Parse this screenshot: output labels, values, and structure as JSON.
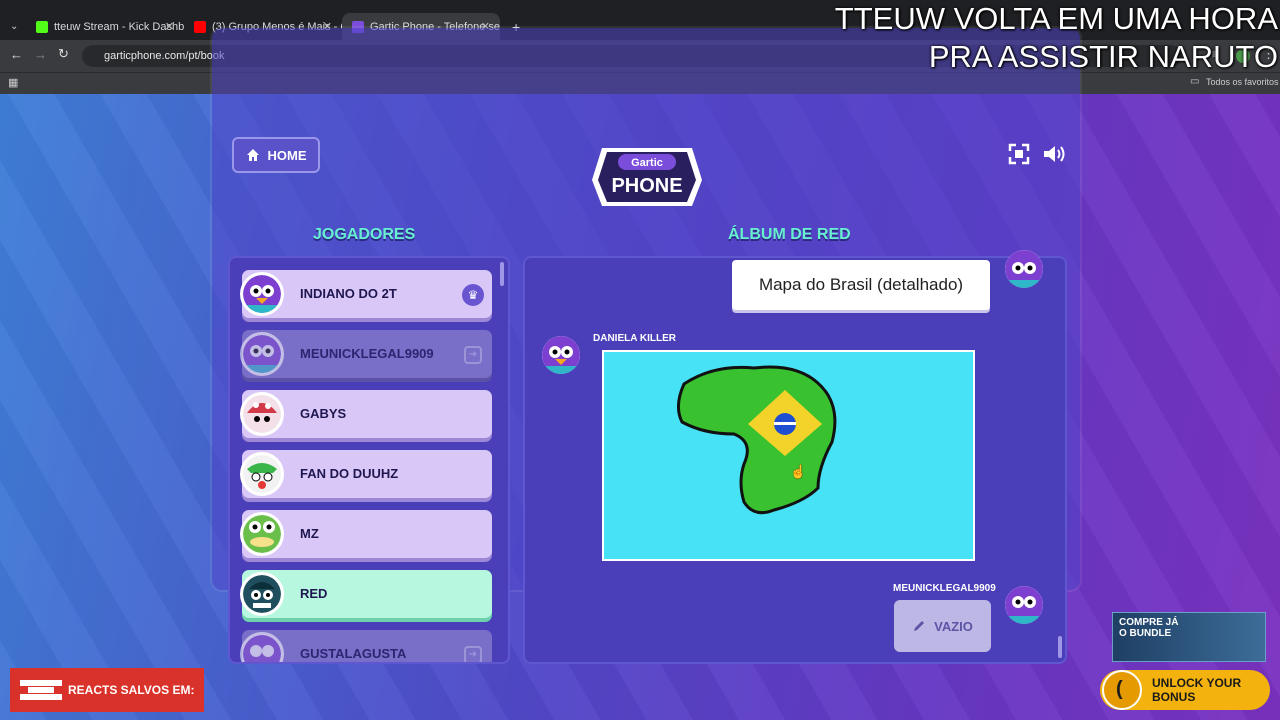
{
  "browser": {
    "tabs": [
      {
        "label": "tteuw Stream - Kick Dashbo",
        "favicon_color": "#53fc18"
      },
      {
        "label": "(3) Grupo Menos é Mais - C",
        "favicon_color": "#ff0000"
      },
      {
        "label": "Gartic Phone - Telefone sem fio",
        "favicon_color": "#7b4ddb"
      }
    ],
    "new_tab": "+",
    "url": "garticphone.com/pt/book",
    "bookmarks_label": "Todos os favoritos"
  },
  "overlay": {
    "line1": "TTEUW VOLTA EM UMA HORA",
    "line2": "PRA ASSISTIR NARUTO"
  },
  "game": {
    "home_label": "HOME",
    "players_title": "JOGADORES",
    "album_title": "ÁLBUM DE RED",
    "players": [
      {
        "name": "INDIANO DO 2T",
        "state": "normal",
        "host": true
      },
      {
        "name": "MEUNICKLEGAL9909",
        "state": "disconnected"
      },
      {
        "name": "GABYS",
        "state": "normal"
      },
      {
        "name": "FAN DO DUUHZ",
        "state": "normal"
      },
      {
        "name": "MZ",
        "state": "normal"
      },
      {
        "name": "RED",
        "state": "active"
      },
      {
        "name": "GUSTALAGUSTA",
        "state": "disconnected"
      }
    ],
    "album": {
      "prompt": "Mapa do Brasil (detalhado)",
      "drawing_author": "DANIELA KILLER",
      "next_author": "MEUNICKLEGAL9909",
      "empty_label": "VAZIO"
    }
  },
  "ads": {
    "reacts": "REACTS SALVOS EM:",
    "promo_line1": "COMPRE JÁ",
    "promo_line2": "O BUNDLE",
    "unlock": "UNLOCK YOUR BONUS"
  },
  "colors": {
    "accent_title": "#66f0cf",
    "drawing_bg": "#48e2f6",
    "active_player": "#b7f7df"
  }
}
